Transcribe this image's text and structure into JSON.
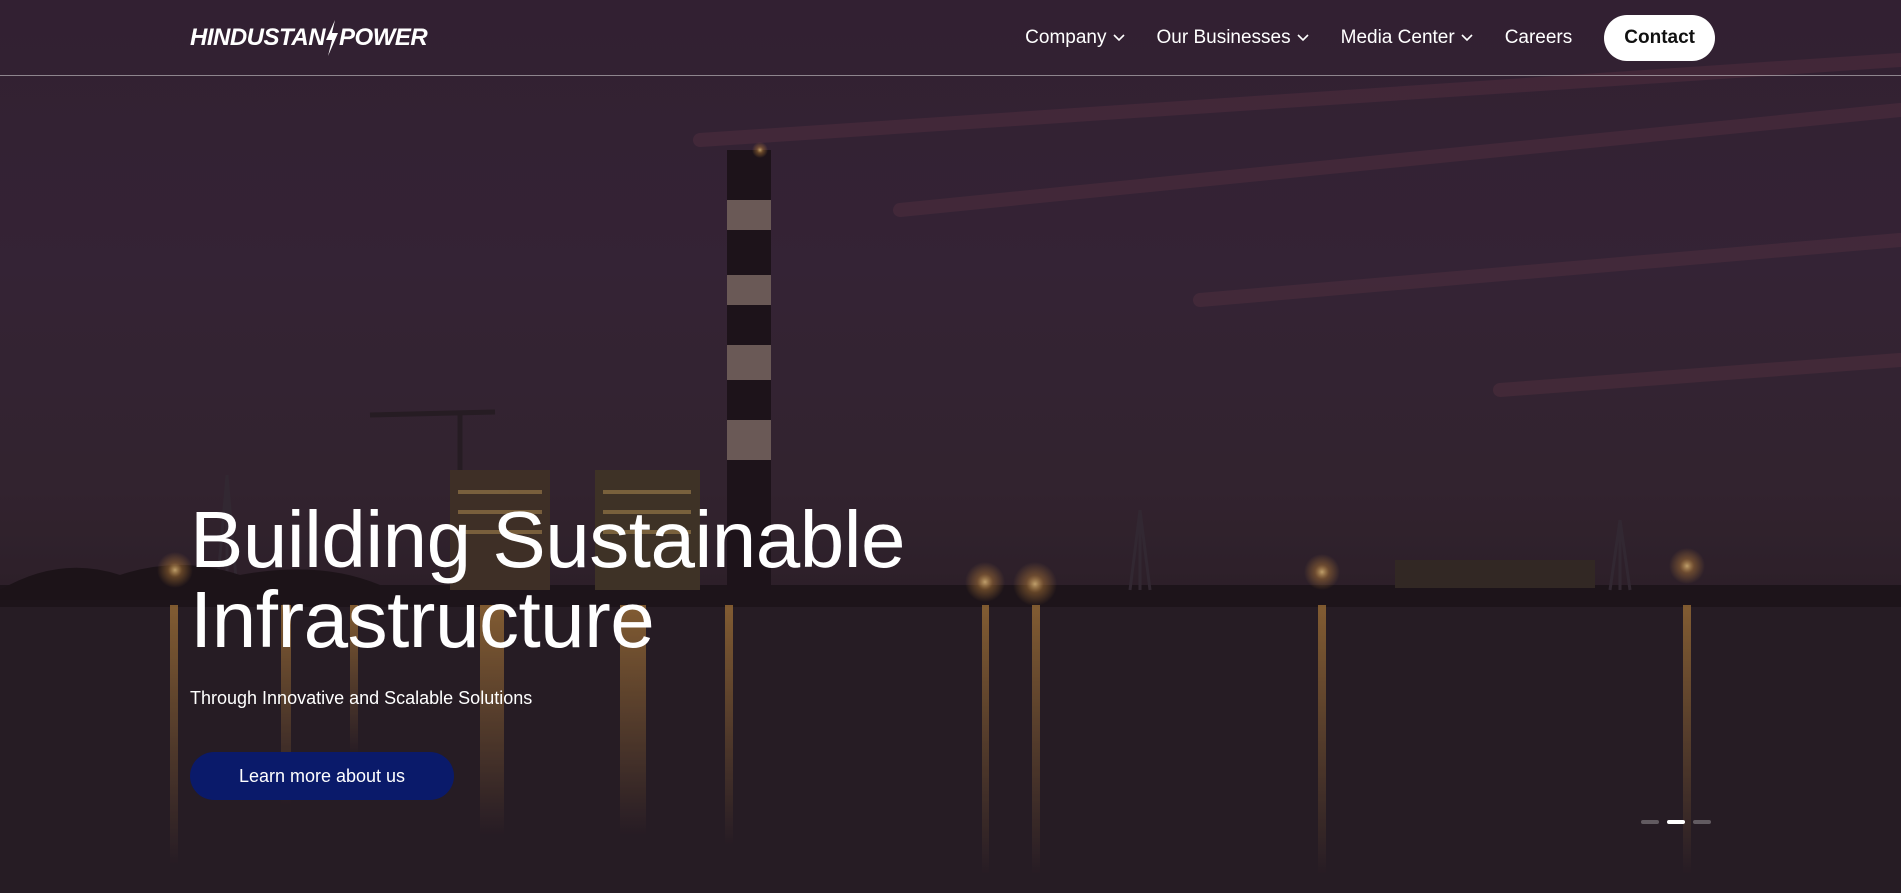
{
  "brand": {
    "logo_left": "HINDUSTAN",
    "logo_right": "POWER"
  },
  "nav": {
    "items": [
      {
        "label": "Company",
        "has_dropdown": true
      },
      {
        "label": "Our Businesses",
        "has_dropdown": true
      },
      {
        "label": "Media Center",
        "has_dropdown": true
      },
      {
        "label": "Careers",
        "has_dropdown": false
      }
    ],
    "contact_label": "Contact"
  },
  "hero": {
    "headline_line1": "Building Sustainable",
    "headline_line2": "Infrastructure",
    "subheadline": "Through Innovative and Scalable Solutions",
    "cta_label": "Learn more about us",
    "slides_total": 3,
    "slide_active": 2
  },
  "colors": {
    "cta_bg": "#0a1a6a",
    "nav_text": "#ffffff",
    "contact_bg": "#ffffff"
  }
}
